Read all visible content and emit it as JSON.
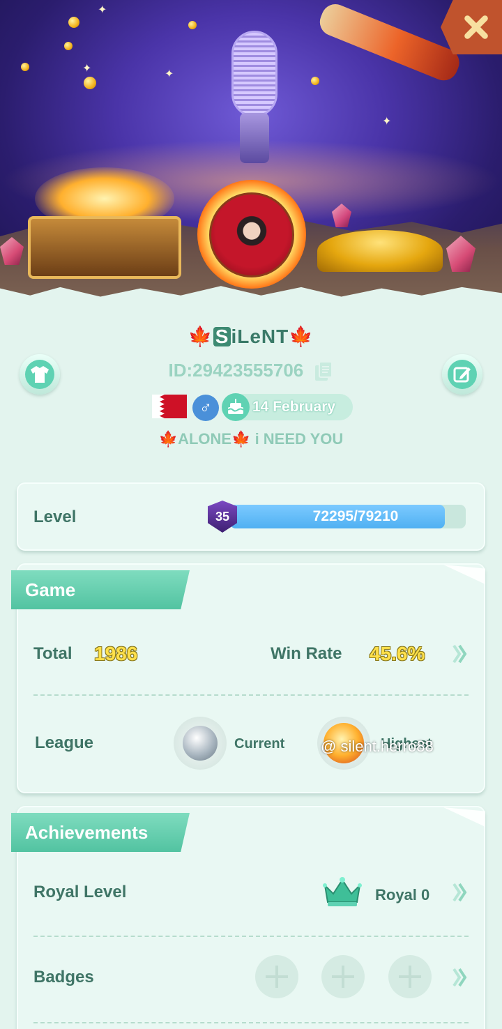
{
  "profile": {
    "name_prefix": "🍁",
    "name_box_letter": "S",
    "name_rest": "iLeNT",
    "name_suffix": "🍁",
    "id_text": "ID:29423555706",
    "birthday": "14 February",
    "gender_symbol": "♂",
    "signature": "🍁ALONE🍁 i NEED YOU"
  },
  "level": {
    "label": "Level",
    "badge": "35",
    "progress_text": "72295/79210",
    "progress_fraction": 0.9127
  },
  "game": {
    "title": "Game",
    "total_label": "Total",
    "total_value": "1986",
    "win_rate_label": "Win Rate",
    "win_rate_value": "45.6%",
    "league_label": "League",
    "current_label": "Current",
    "highest_label": "Highest"
  },
  "achievements": {
    "title": "Achievements",
    "royal_label": "Royal Level",
    "royal_value": "Royal 0",
    "badges_label": "Badges"
  },
  "watermark": "@ silent.herro88",
  "colors": {
    "accent": "#5fd2b3",
    "background": "#e3f4ee",
    "text": "#3f7566",
    "close": "#c0532d",
    "level_fill": "#4fb0f2"
  }
}
